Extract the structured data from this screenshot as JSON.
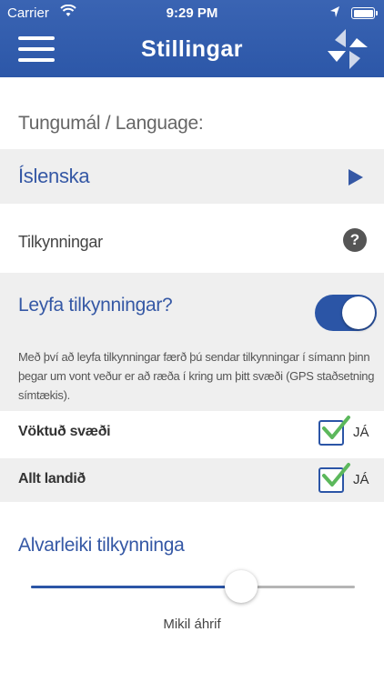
{
  "status_bar": {
    "carrier": "Carrier",
    "time": "9:29 PM",
    "wifi_icon": "wifi-icon",
    "location_icon": "location-arrow-icon",
    "battery_icon": "battery-icon"
  },
  "nav": {
    "title": "Stillingar",
    "menu_icon": "hamburger-menu-icon",
    "logo_icon": "app-logo-icon",
    "background_color": "#2c57a8"
  },
  "language": {
    "section_label": "Tungumál / Language:",
    "selected": "Íslenska"
  },
  "notifications": {
    "section_label": "Tilkynningar",
    "help_label": "?",
    "allow_label": "Leyfa tilkynningar?",
    "allow_enabled": true,
    "description": "Með því að leyfa tilkynningar færð þú sendar tilkynningar í símann þinn þegar um vont veður er að ræða í kring um þitt svæði (GPS staðsetning símtækis).",
    "options": [
      {
        "label": "Vöktuð svæði",
        "checked": true,
        "value_label": "JÁ"
      },
      {
        "label": "Allt landið",
        "checked": true,
        "value_label": "JÁ"
      }
    ]
  },
  "severity": {
    "title": "Alvarleiki tilkynninga",
    "level_fraction": 0.65,
    "value_label": "Mikil áhrif"
  },
  "colors": {
    "accent": "#2b55a6",
    "check_green": "#5cb85c",
    "row_gray": "#efefef"
  }
}
